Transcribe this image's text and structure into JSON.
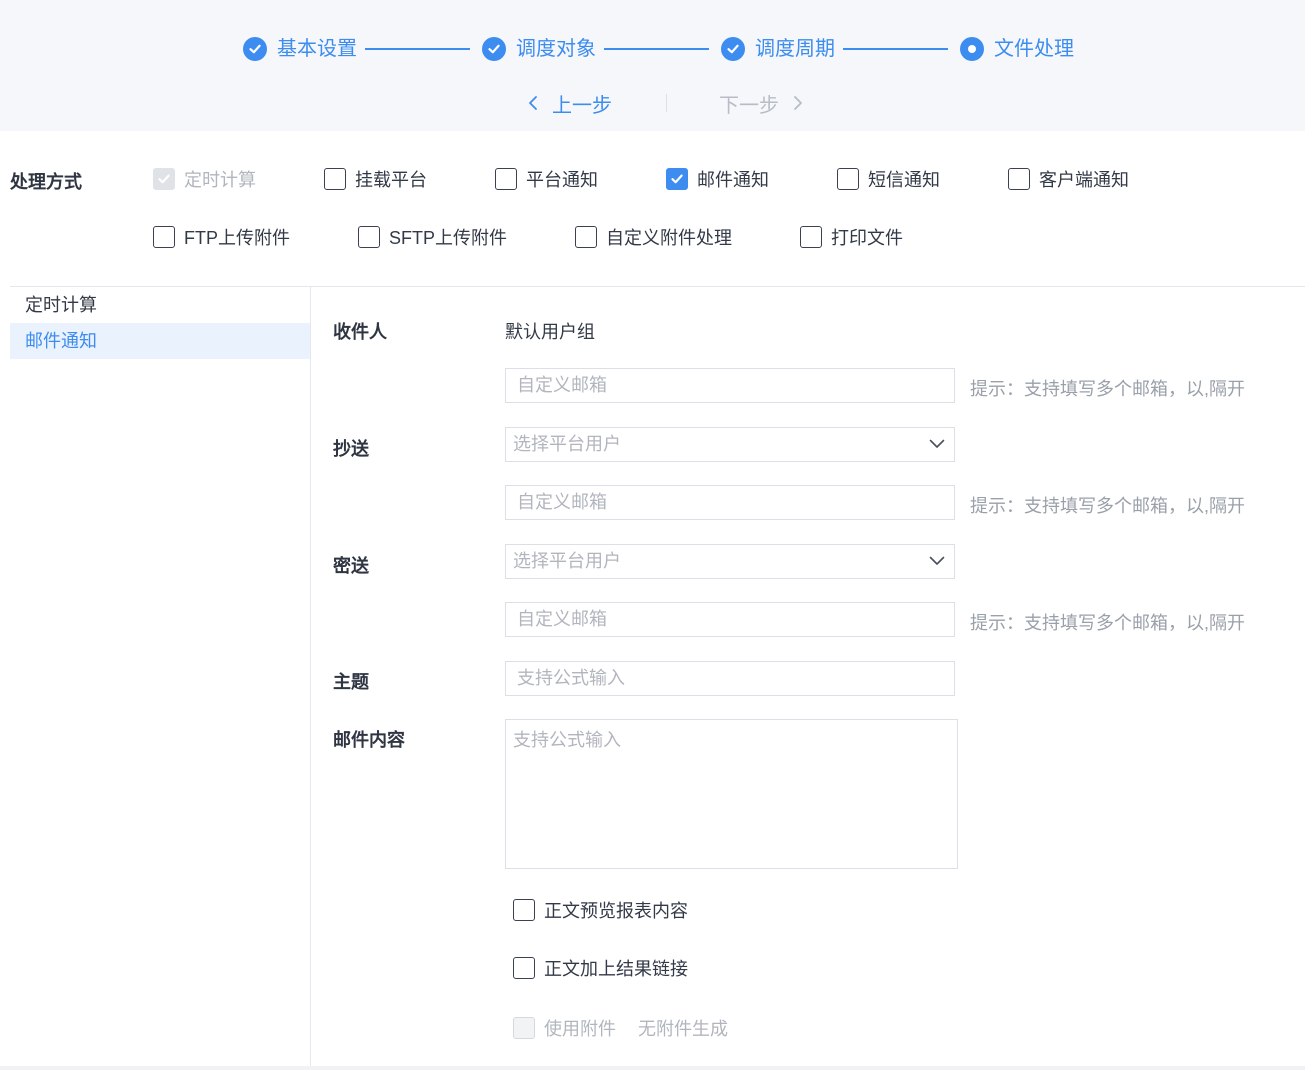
{
  "colors": {
    "accent": "#3d8cf0",
    "disabled": "#b1b6be",
    "border": "#dcdfe6"
  },
  "stepper": {
    "steps": [
      {
        "label": "基本设置",
        "status": "done"
      },
      {
        "label": "调度对象",
        "status": "done"
      },
      {
        "label": "调度周期",
        "status": "done"
      },
      {
        "label": "文件处理",
        "status": "current"
      }
    ],
    "prev_label": "上一步",
    "next_label": "下一步"
  },
  "methods": {
    "title": "处理方式",
    "options": [
      {
        "label": "定时计算",
        "checked": true,
        "disabled": true
      },
      {
        "label": "挂载平台",
        "checked": false
      },
      {
        "label": "平台通知",
        "checked": false
      },
      {
        "label": "邮件通知",
        "checked": true
      },
      {
        "label": "短信通知",
        "checked": false
      },
      {
        "label": "客户端通知",
        "checked": false
      },
      {
        "label": "FTP上传附件",
        "checked": false
      },
      {
        "label": "SFTP上传附件",
        "checked": false
      },
      {
        "label": "自定义附件处理",
        "checked": false
      },
      {
        "label": "打印文件",
        "checked": false
      }
    ]
  },
  "sidebar": {
    "items": [
      {
        "label": "定时计算",
        "active": false
      },
      {
        "label": "邮件通知",
        "active": true
      }
    ]
  },
  "form": {
    "recipient": {
      "label": "收件人",
      "group": "默认用户组",
      "email_placeholder": "自定义邮箱",
      "hint": "提示：支持填写多个邮箱，以,隔开"
    },
    "cc": {
      "label": "抄送",
      "select_placeholder": "选择平台用户",
      "email_placeholder": "自定义邮箱",
      "hint": "提示：支持填写多个邮箱，以,隔开"
    },
    "bcc": {
      "label": "密送",
      "select_placeholder": "选择平台用户",
      "email_placeholder": "自定义邮箱",
      "hint": "提示：支持填写多个邮箱，以,隔开"
    },
    "subject": {
      "label": "主题",
      "placeholder": "支持公式输入"
    },
    "content": {
      "label": "邮件内容",
      "placeholder": "支持公式输入"
    },
    "options": [
      {
        "label": "正文预览报表内容",
        "checked": false
      },
      {
        "label": "正文加上结果链接",
        "checked": false
      },
      {
        "label": "使用附件",
        "checked": false,
        "disabled": true,
        "note": "无附件生成"
      }
    ]
  }
}
